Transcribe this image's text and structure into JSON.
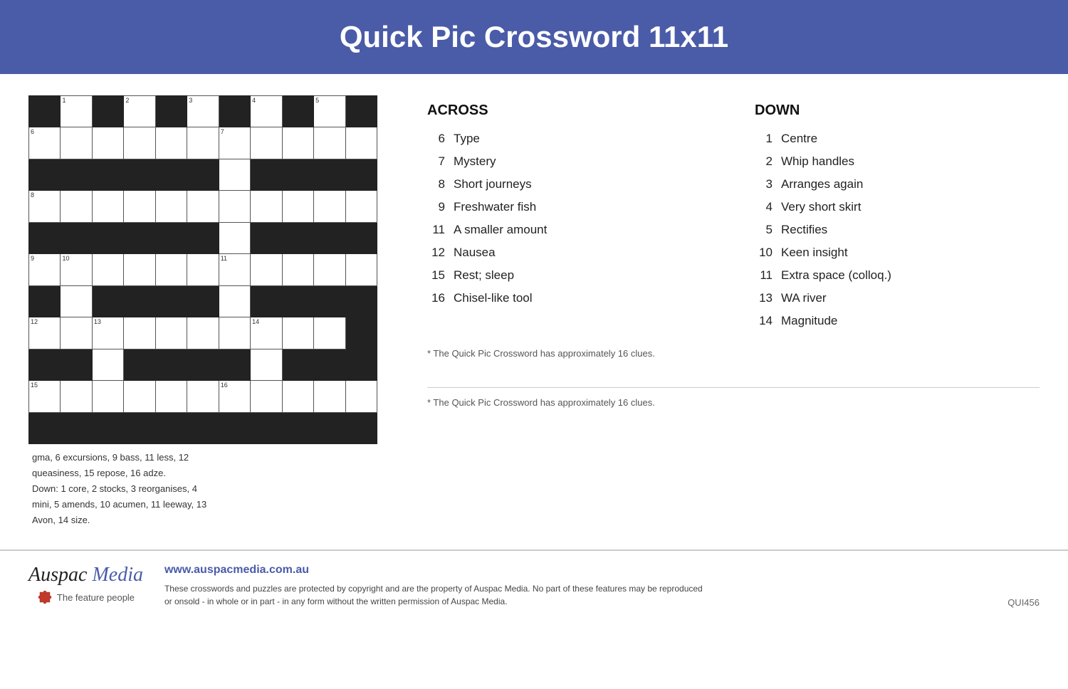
{
  "header": {
    "title": "Quick Pic Crossword 11x11"
  },
  "across_clues": [
    {
      "num": "6",
      "text": "Type"
    },
    {
      "num": "7",
      "text": "Mystery"
    },
    {
      "num": "8",
      "text": "Short journeys"
    },
    {
      "num": "9",
      "text": "Freshwater fish"
    },
    {
      "num": "11",
      "text": "A smaller amount"
    },
    {
      "num": "12",
      "text": "Nausea"
    },
    {
      "num": "15",
      "text": "Rest; sleep"
    },
    {
      "num": "16",
      "text": "Chisel-like tool"
    }
  ],
  "down_clues": [
    {
      "num": "1",
      "text": "Centre"
    },
    {
      "num": "2",
      "text": "Whip handles"
    },
    {
      "num": "3",
      "text": "Arranges again"
    },
    {
      "num": "4",
      "text": "Very short skirt"
    },
    {
      "num": "5",
      "text": "Rectifies"
    },
    {
      "num": "10",
      "text": "Keen insight"
    },
    {
      "num": "11",
      "text": "Extra space (colloq.)"
    },
    {
      "num": "13",
      "text": "WA river"
    },
    {
      "num": "14",
      "text": "Magnitude"
    }
  ],
  "answers": {
    "line1": "gma, 6 excursions, 9 bass, 11 less, 12",
    "line2": "queasiness, 15 repose, 16 adze.",
    "line3": "Down: 1 core, 2 stocks, 3 reorganises, 4",
    "line4": "mini, 5 amends, 10 acumen, 11 leeway, 13",
    "line5": "Avon, 14 size."
  },
  "footnote": "* The Quick Pic Crossword has approximately 16 clues.",
  "footer": {
    "url": "www.auspacmedia.com.au",
    "logo_main": "Auspac Media",
    "logo_sub": "The feature people",
    "copyright": "These crosswords and puzzles are protected by copyright and are the property of Auspac Media. No part of these features may be reproduced\nor onsold - in whole or in part - in any form without the written permission of Auspac Media.",
    "product_id": "QUI456"
  },
  "labels": {
    "across": "ACROSS",
    "down": "DOWN"
  }
}
